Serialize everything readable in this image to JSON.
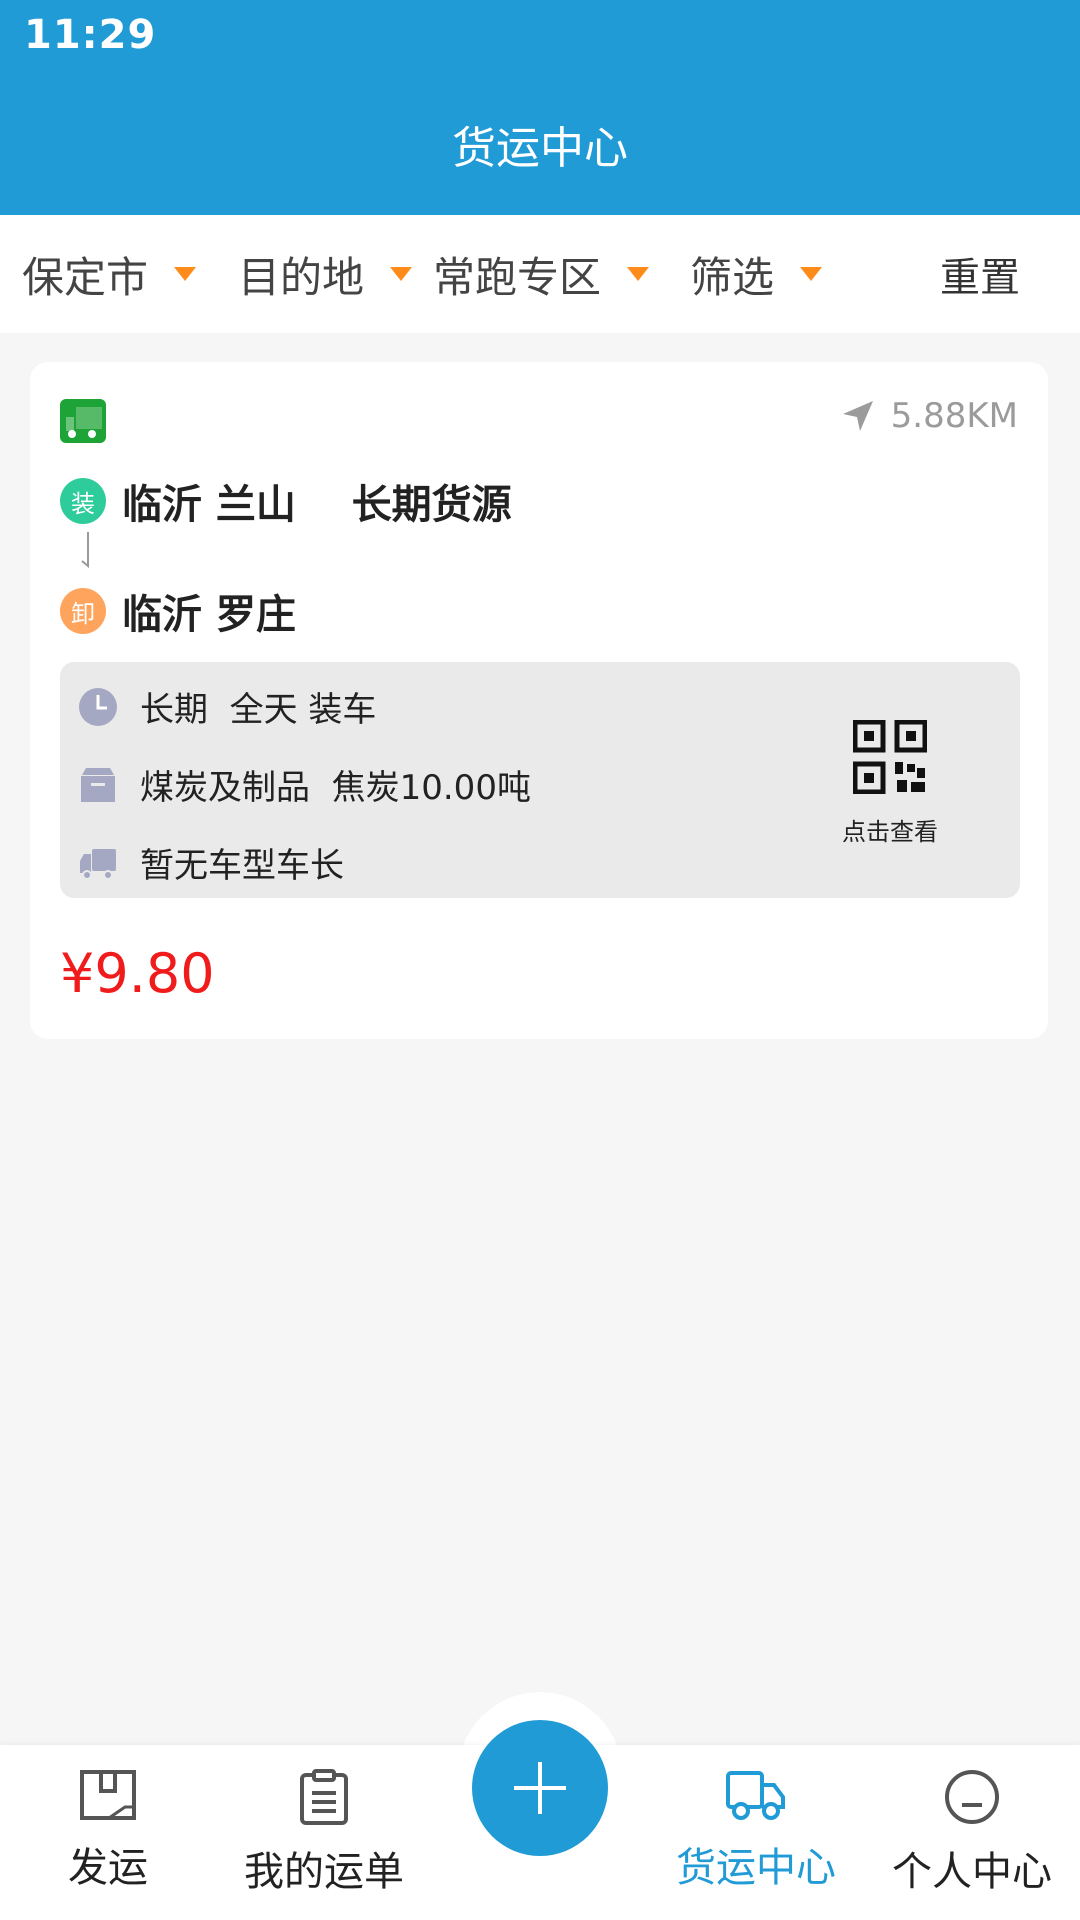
{
  "status_bar": {
    "time": "11:29"
  },
  "header": {
    "title": "货运中心"
  },
  "filters": {
    "origin": "保定市",
    "destination": "目的地",
    "zone": "常跑专区",
    "filter": "筛选",
    "reset": "重置"
  },
  "listing": {
    "distance": "5.88KM",
    "load": {
      "tag": "装",
      "text": "临沂 兰山    长期货源"
    },
    "unload": {
      "tag": "卸",
      "text": "临沂 罗庄"
    },
    "time_info": "长期  全天 装车",
    "cargo_info": "煤炭及制品  焦炭10.00吨",
    "vehicle_info": "暂无车型车长",
    "qr_label": "点击查看",
    "price": "¥9.80"
  },
  "tabbar": {
    "tabs": [
      {
        "label": "发运"
      },
      {
        "label": "我的运单"
      },
      {
        "label": "货运中心"
      },
      {
        "label": "个人中心"
      }
    ],
    "active_tab": "货运中心"
  },
  "colors": {
    "primary": "#209bd6",
    "price": "#f01c1c",
    "arrow": "#ff8c1a",
    "load_tag": "#2ecc9a",
    "unload_tag": "#ffa45c"
  }
}
